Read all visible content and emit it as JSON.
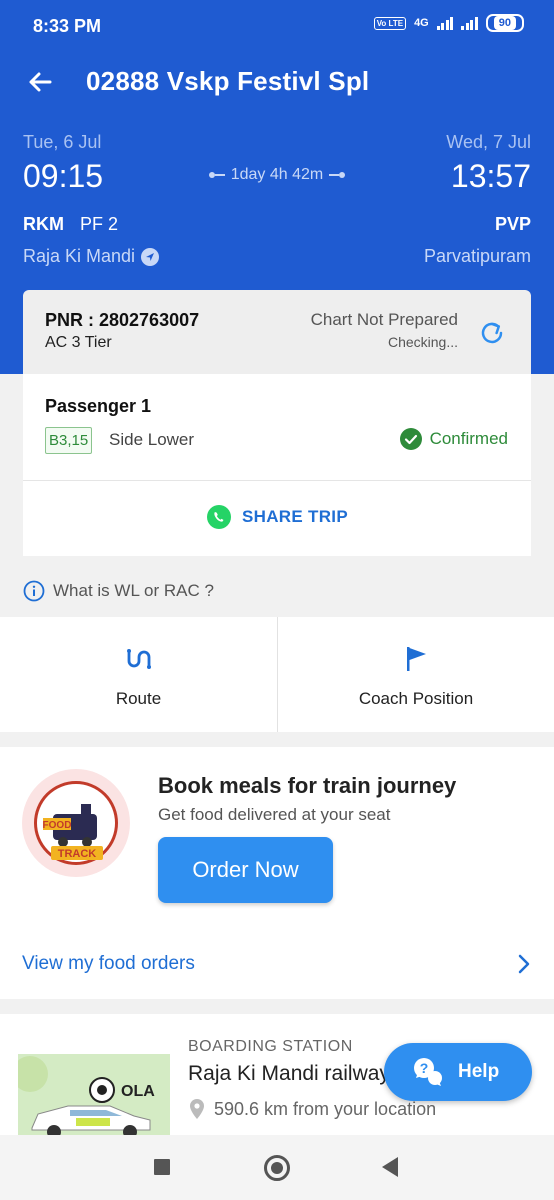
{
  "status_bar": {
    "time": "8:33 PM",
    "network": "4G",
    "volte": "Vo LTE",
    "battery": "90"
  },
  "header": {
    "title": "02888 Vskp Festivl Spl",
    "back_icon": "arrow-left-icon"
  },
  "journey": {
    "departure": {
      "date": "Tue, 6 Jul",
      "time": "09:15",
      "code": "RKM",
      "platform": "PF 2",
      "station": "Raja Ki Mandi"
    },
    "arrival": {
      "date": "Wed, 7 Jul",
      "time": "13:57",
      "code": "PVP",
      "station": "Parvatipuram"
    },
    "duration": "1day 4h 42m"
  },
  "pnr": {
    "label": "PNR : 2802763007",
    "class": "AC 3 Tier",
    "chart_status": "Chart Not Prepared",
    "chart_sub": "Checking..."
  },
  "passenger": {
    "title": "Passenger 1",
    "berth": "B3,15",
    "berth_type": "Side Lower",
    "status": "Confirmed"
  },
  "share": {
    "label": "SHARE TRIP"
  },
  "wl_info": {
    "label": "What is WL or RAC ?"
  },
  "actions": [
    {
      "label": "Route",
      "icon": "route-icon"
    },
    {
      "label": "Coach Position",
      "icon": "flag-icon"
    }
  ],
  "food": {
    "title": "Book meals for train journey",
    "subtitle": "Get food delivered at your seat",
    "button": "Order Now",
    "link": "View my food orders",
    "logo_text_top": "FOOD",
    "logo_text_bottom": "TRACK"
  },
  "boarding": {
    "label": "BOARDING STATION",
    "name": "Raja Ki Mandi railway station",
    "distance": "590.6 km from your location",
    "ad_brand": "OLA"
  },
  "help": {
    "label": "Help"
  },
  "colors": {
    "primary": "#1f5bd1",
    "accent": "#2f8ff0",
    "success": "#2e8b3a",
    "link": "#1f6ed4"
  }
}
